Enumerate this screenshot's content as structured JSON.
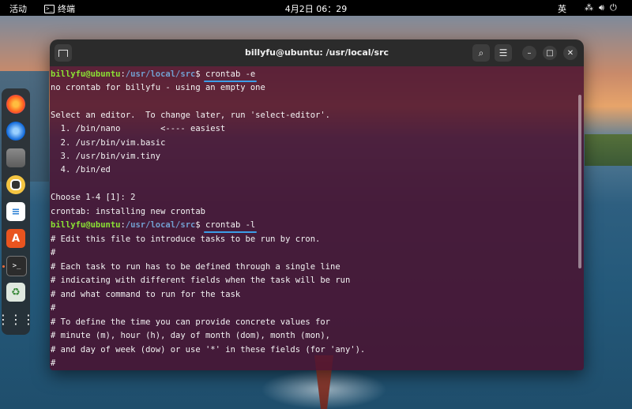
{
  "topbar": {
    "activities": "活动",
    "app_name": "终端",
    "clock": "4月2日  06：29",
    "ime": "英",
    "tray_icons": [
      "network-icon",
      "volume-icon",
      "power-icon"
    ]
  },
  "dock": {
    "apps": [
      "firefox",
      "thunderbird",
      "files",
      "rhythmbox",
      "libreoffice-writer",
      "ubuntu-software",
      "terminal",
      "trash",
      "show-apps"
    ]
  },
  "window": {
    "title": "billyfu@ubuntu: /usr/local/src"
  },
  "terminal": {
    "prompt_user": "billyfu@ubuntu",
    "prompt_path": "/usr/local/src",
    "command1": "crontab -e",
    "command2": "crontab -l",
    "lines": [
      "no crontab for billyfu - using an empty one",
      "",
      "Select an editor.  To change later, run 'select-editor'.",
      "  1. /bin/nano        <---- easiest",
      "  2. /usr/bin/vim.basic",
      "  3. /usr/bin/vim.tiny",
      "  4. /bin/ed",
      "",
      "Choose 1-4 [1]: 2",
      "crontab: installing new crontab"
    ],
    "crontab_lines": [
      "# Edit this file to introduce tasks to be run by cron.",
      "#",
      "# Each task to run has to be defined through a single line",
      "# indicating with different fields when the task will be run",
      "# and what command to run for the task",
      "#",
      "# To define the time you can provide concrete values for",
      "# minute (m), hour (h), day of month (dom), month (mon),",
      "# and day of week (dow) or use '*' in these fields (for 'any').",
      "#"
    ]
  },
  "colors": {
    "terminal_bg": "#4a1230",
    "prompt_user": "#8ae234",
    "prompt_path": "#729fcf",
    "highlight": "#3c9ee8"
  }
}
